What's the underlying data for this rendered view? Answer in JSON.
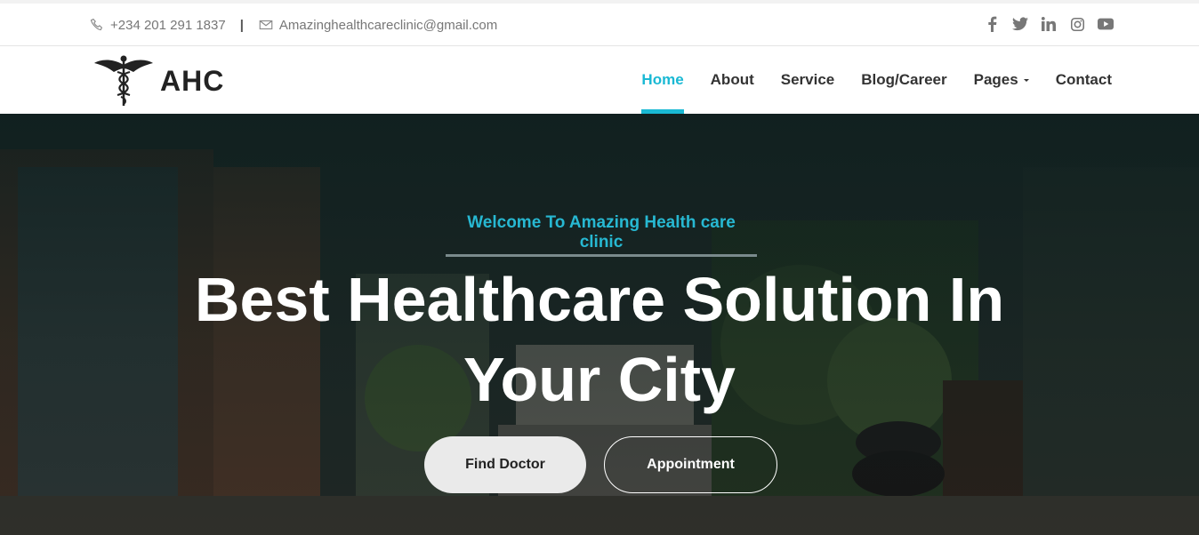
{
  "topbar": {
    "phone": "+234 201 291 1837",
    "separator": "|",
    "email": "Amazinghealthcareclinic@gmail.com",
    "social": [
      "facebook-icon",
      "twitter-icon",
      "linkedin-icon",
      "instagram-icon",
      "youtube-icon"
    ]
  },
  "brand": {
    "name": "AHC",
    "logo_icon": "caduceus-icon"
  },
  "nav": {
    "items": [
      {
        "label": "Home"
      },
      {
        "label": "About"
      },
      {
        "label": "Service"
      },
      {
        "label": "Blog/Career"
      },
      {
        "label": "Pages"
      },
      {
        "label": "Contact"
      }
    ],
    "active_index": 0,
    "accent": "#1ab9d4"
  },
  "hero": {
    "welcome": "Welcome To Amazing Health care clinic",
    "headline_line1": "Best Healthcare Solution In",
    "headline_line2": "Your City",
    "buttons": {
      "find": "Find Doctor",
      "appointment": "Appointment"
    }
  }
}
